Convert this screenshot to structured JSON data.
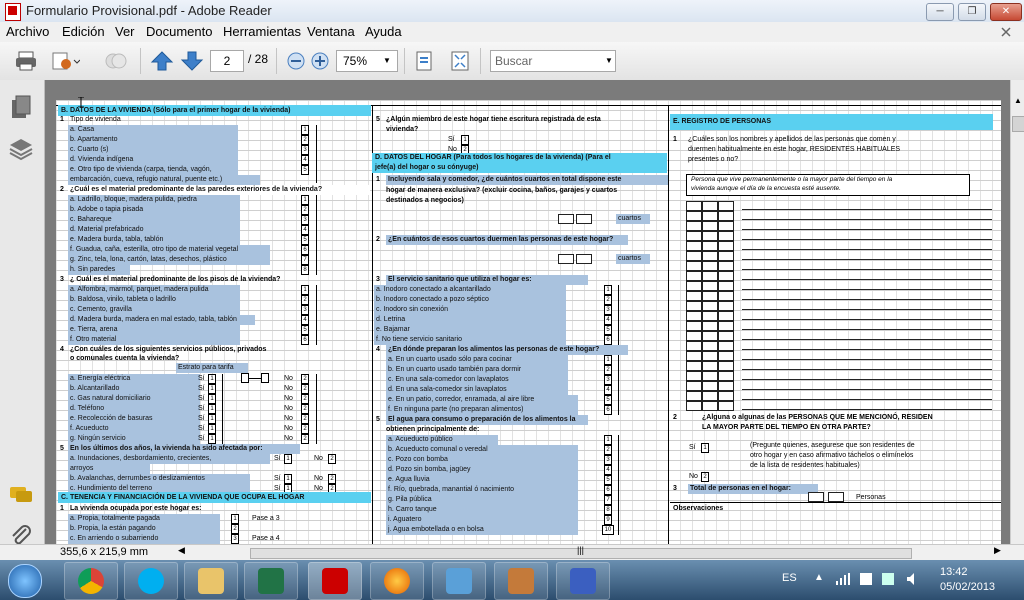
{
  "window": {
    "title": "Formulario Provisional.pdf - Adobe Reader"
  },
  "menu": [
    "Archivo",
    "Edición",
    "Ver",
    "Documento",
    "Herramientas",
    "Ventana",
    "Ayuda"
  ],
  "toolbar": {
    "page_current": "2",
    "page_total": "/ 28",
    "zoom": "75%",
    "search_placeholder": "Buscar"
  },
  "status": {
    "page_size": "355,6 x 215,9 mm"
  },
  "form": {
    "B": {
      "header": "B.    DATOS DE LA VIVIENDA (Sólo para el primer hogar de la vivienda)",
      "q1": {
        "label": "Tipo de vivienda",
        "options": [
          "a.  Casa",
          "b.  Apartamento",
          "c.  Cuarto (s)",
          "d.  Vivienda indígena",
          "e.  Otro tipo de vivienda (carpa, tienda,  vagón,",
          "     embarcación, cueva, refugio natural, puente etc.)"
        ]
      },
      "q2": {
        "label": "¿Cuál es el material predominante de las paredes exteriores de la vivienda?",
        "options": [
          "a.  Ladrillo, bloque, madera pulida, piedra",
          "b.  Adobe o tapia pisada",
          "c.  Bahareque",
          "d.  Material prefabricado",
          "e.  Madera burda, tabla, tablón",
          "f.  Guadua, caña, esterilla, otro tipo de material vegetal",
          "g.  Zinc, tela, lona, cartón, latas, desechos, plástico",
          "h.  Sin paredes"
        ]
      },
      "q3": {
        "label": "¿ Cuál es el material predominante de los pisos de la vivienda?",
        "options": [
          "a.  Alfombra, marmol, parquet, madera pulida",
          "b.  Baldosa, vinilo, tableta o ladrillo",
          "c.  Cemento, gravilla",
          "d.  Madera burda, madera en mal estado, tabla, tablón",
          "e.  Tierra, arena",
          "f.  Otro material"
        ]
      },
      "q4": {
        "label": "¿Con cuáles de los siguientes servicios públicos, privados",
        "label2": "o comunales cuenta la vivienda?",
        "estrato": "Estrato para tarifa",
        "options": [
          "a.  Energía eléctrica",
          "b.  Alcantarillado",
          "c.  Gas natural domiciliario",
          "d.  Teléfono",
          "e.  Recolección de basuras",
          "f.  Acueducto",
          "g.  Ningún servicio"
        ],
        "si": "Sí",
        "no": "No"
      },
      "q5": {
        "label": "En los últimos dos años, la vivienda ha sido afectada por:",
        "options": [
          "a.  Inundaciones, desbordamiento, crecientes,",
          "     arroyos",
          "b.  Avalanchas, derrumbes o deslizamientos",
          "c.  Hundimiento del terreno"
        ]
      }
    },
    "C": {
      "header": "C.  TENENCIA Y FINANCIACIÓN DE LA VIVIENDA QUE OCUPA EL HOGAR",
      "q1": {
        "label": "La vivienda ocupada por este hogar es:",
        "options": [
          "a.  Propia, totalmente pagada",
          "b.  Propia, la están pagando",
          "c.  En arriendo o subarriendo"
        ],
        "pase": [
          "Pase a 3",
          "Pase a 4"
        ]
      }
    },
    "Bq5b": {
      "label": "¿Algún miembro de este hogar tiene escritura registrada de esta",
      "label2": "vivienda?",
      "si": "Sí",
      "no": "No"
    },
    "D": {
      "header": "D. DATOS   DEL HOGAR (Para todos los hogares de la vivienda) (Para el",
      "header2": "jefe(a) del hogar o su cónyuge)",
      "q1": {
        "lines": [
          "Incluyendo sala y comedor, ¿de cuántos cuartos en total dispone este",
          "hogar  de  manera  exclusiva?  (excluir  cocina,  baños,  garajes  y  cuartos",
          "destinados  a negocios)"
        ],
        "cuartos": "cuartos"
      },
      "q2": {
        "label": "¿En cuántos de esos cuartos duermen las personas de este hogar?",
        "cuartos": "cuartos"
      },
      "q3": {
        "label": "El servicio sanitario que utiliza el hogar es:",
        "options": [
          "a.  Inodoro conectado a alcantarillado",
          "b.  Inodoro conectado a pozo séptico",
          "c.  Inodoro sin conexión",
          "d.  Letrina",
          "e.  Bajamar",
          "f.  No tiene servicio sanitario"
        ]
      },
      "q4": {
        "label": "¿En dónde preparan los alimentos las personas de este hogar?",
        "options": [
          "a.  En un cuarto usado sólo para cocinar",
          "b.  En un cuarto usado también para dormir",
          "c.  En una sala-comedor con lavaplatos",
          "d.  En una sala-comedor sin lavaplatos",
          "e.  En un patio, corredor, enramada, al aire libre",
          "f.  En ninguna parte (no preparan alimentos)"
        ]
      },
      "q5": {
        "label": "El agua para consumo o preparación de los alimentos la",
        "label2": "obtienen principalmente de:",
        "options": [
          "a.     Acueducto público",
          "b.  Acueducto comunal o veredal",
          "c.  Pozo con bomba",
          "d.  Pozo sin bomba, jagüey",
          "e.  Agua lluvia",
          "f.   Río, quebrada, manantial ó nacimiento",
          "g.  Pila pública",
          "h.  Carro tanque",
          "i.   Aguatero",
          "j.   Agua embotellada o en bolsa"
        ]
      }
    },
    "E": {
      "header": "E. REGISTRO DE PERSONAS",
      "q1": [
        "¿Cuáles son los nombres y apellidos de las personas que comen y",
        "duermen habitualmente en este hogar, RESIDENTES HABITUALES",
        "presentes o no?"
      ],
      "note": [
        "Persona que vive permanentemente o la mayor parte del tiempo en la",
        "vivienda aunque el día de la encuesta esté ausente."
      ],
      "q2": [
        "¿Alguna  o algunas de las PERSONAS QUE ME MENCIONÓ, RESIDEN",
        "LA MAYOR PARTE DEL TIEMPO EN OTRA PARTE?"
      ],
      "q2note": [
        "(Pregunte quienes, asegurese que son residentes de",
        "otro hogar y en caso afirmativo táchelos o elimínelos",
        "de la lista de residentes habituales)"
      ],
      "q3": "Total de personas en el hogar:",
      "personas": "Personas",
      "obs": "Observaciones"
    }
  },
  "tray": {
    "lang": "ES",
    "time": "13:42",
    "date": "05/02/2013"
  },
  "colors": {
    "section_header": "#5ad0f0",
    "option_highlight": "#a9c2de"
  }
}
